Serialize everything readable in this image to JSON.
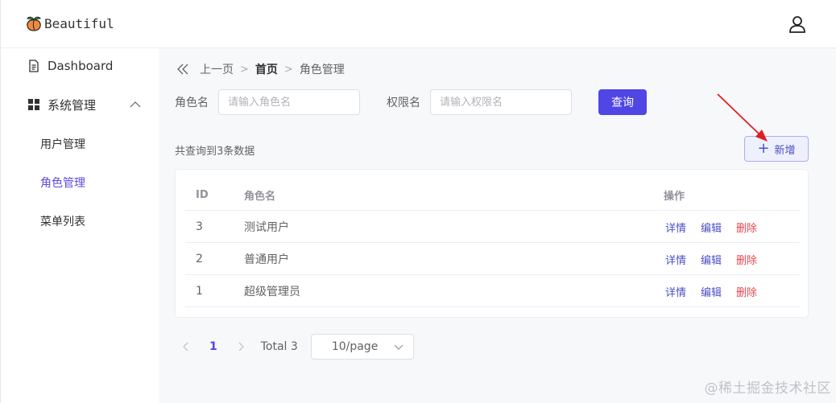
{
  "header": {
    "brand": "Beautiful",
    "logo_icon": "peach-icon",
    "user_icon": "user-icon"
  },
  "sidebar": {
    "items": [
      {
        "label": "Dashboard",
        "icon": "document-icon"
      },
      {
        "label": "系统管理",
        "icon": "grid-icon",
        "expanded": true,
        "children": [
          {
            "label": "用户管理",
            "active": false
          },
          {
            "label": "角色管理",
            "active": true
          },
          {
            "label": "菜单列表",
            "active": false
          }
        ]
      }
    ]
  },
  "breadcrumb": {
    "back": "上一页",
    "home": "首页",
    "current": "角色管理"
  },
  "filters": {
    "role_label": "角色名",
    "role_placeholder": "请输入角色名",
    "perm_label": "权限名",
    "perm_placeholder": "请输入权限名",
    "query_button": "查询"
  },
  "summary": {
    "prefix": "共查询到",
    "count": "3",
    "suffix": "条数据"
  },
  "add_button": "新增",
  "table": {
    "columns": [
      "ID",
      "角色名",
      "操作"
    ],
    "rows": [
      {
        "id": "3",
        "name": "测试用户"
      },
      {
        "id": "2",
        "name": "普通用户"
      },
      {
        "id": "1",
        "name": "超级管理员"
      }
    ],
    "actions": {
      "detail": "详情",
      "edit": "编辑",
      "delete": "删除"
    }
  },
  "pagination": {
    "current_page": "1",
    "total": "Total 3",
    "page_size": "10/page"
  },
  "watermark": "@稀土掘金技术社区",
  "colors": {
    "primary": "#5046e5",
    "link": "#4b4fc4",
    "danger": "#e5484d",
    "annotation": "#e02020"
  }
}
